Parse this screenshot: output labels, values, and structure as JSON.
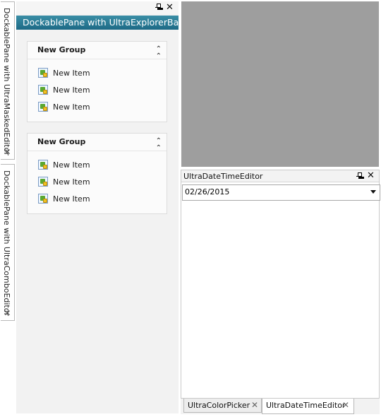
{
  "left_tabs": [
    {
      "label": "DockablePane with UltraMaskedEditor",
      "close_glyph": "✕"
    },
    {
      "label": "DockablePane with UltraComboEditor",
      "close_glyph": "✕"
    }
  ],
  "explorer_pane": {
    "title": "DockablePane with UltraExplorerBar",
    "pin_icon": "pin-icon",
    "close_glyph": "✕",
    "groups": [
      {
        "title": "New Group",
        "collapse_glyph": "⌃",
        "items": [
          "New Item",
          "New Item",
          "New Item"
        ]
      },
      {
        "title": "New Group",
        "collapse_glyph": "⌃",
        "items": [
          "New Item",
          "New Item",
          "New Item"
        ]
      }
    ]
  },
  "date_pane": {
    "title": "UltraDateTimeEditor",
    "close_glyph": "✕",
    "date_value": "02/26/2015"
  },
  "bottom_tabs": [
    {
      "label": "UltraColorPicker",
      "close_glyph": "✕",
      "active": false
    },
    {
      "label": "UltraDateTimeEditor",
      "close_glyph": "✕",
      "active": true
    }
  ],
  "colors": {
    "title_bar": "#1d6a86",
    "gray_area": "#9e9e9e",
    "pane_background": "#f2f2f2"
  }
}
